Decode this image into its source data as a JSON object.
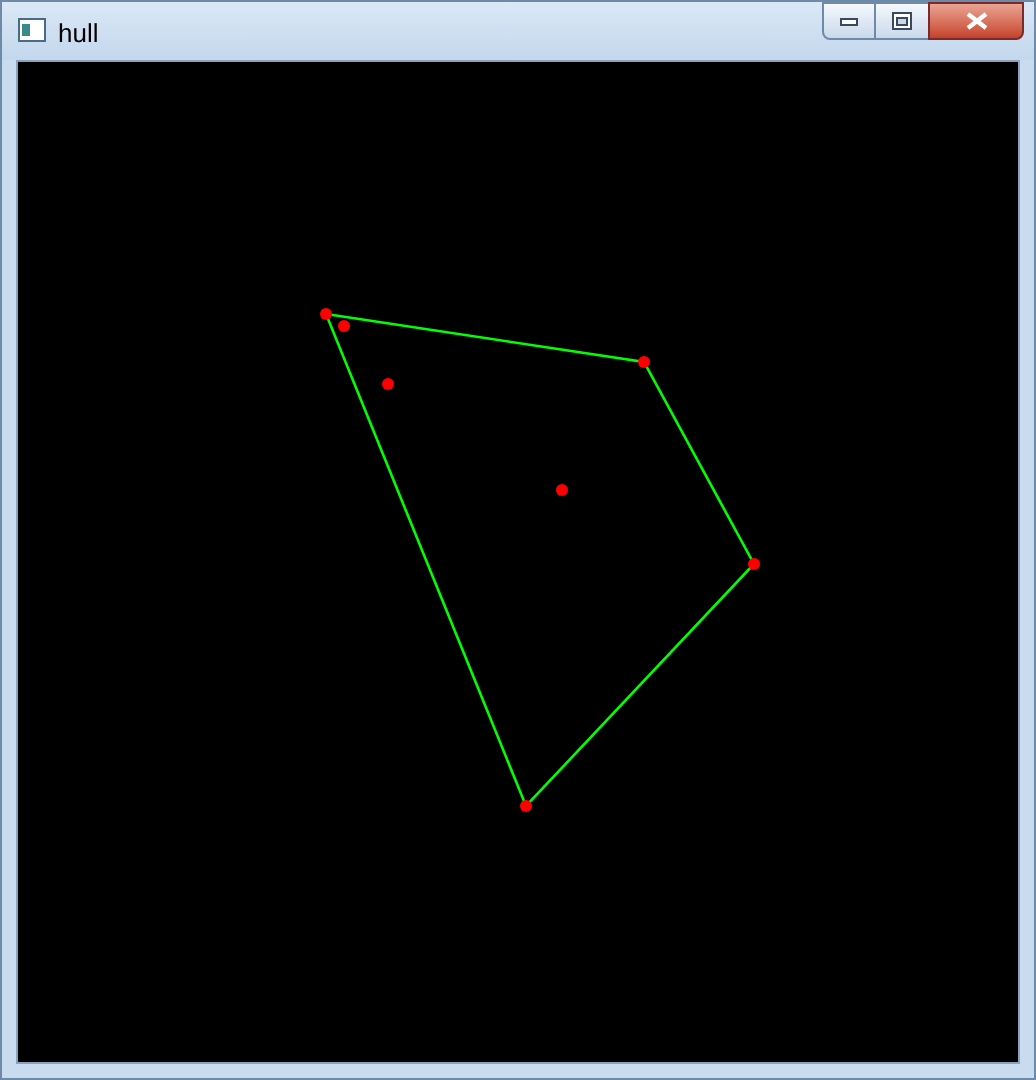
{
  "window": {
    "title": "hull"
  }
}
